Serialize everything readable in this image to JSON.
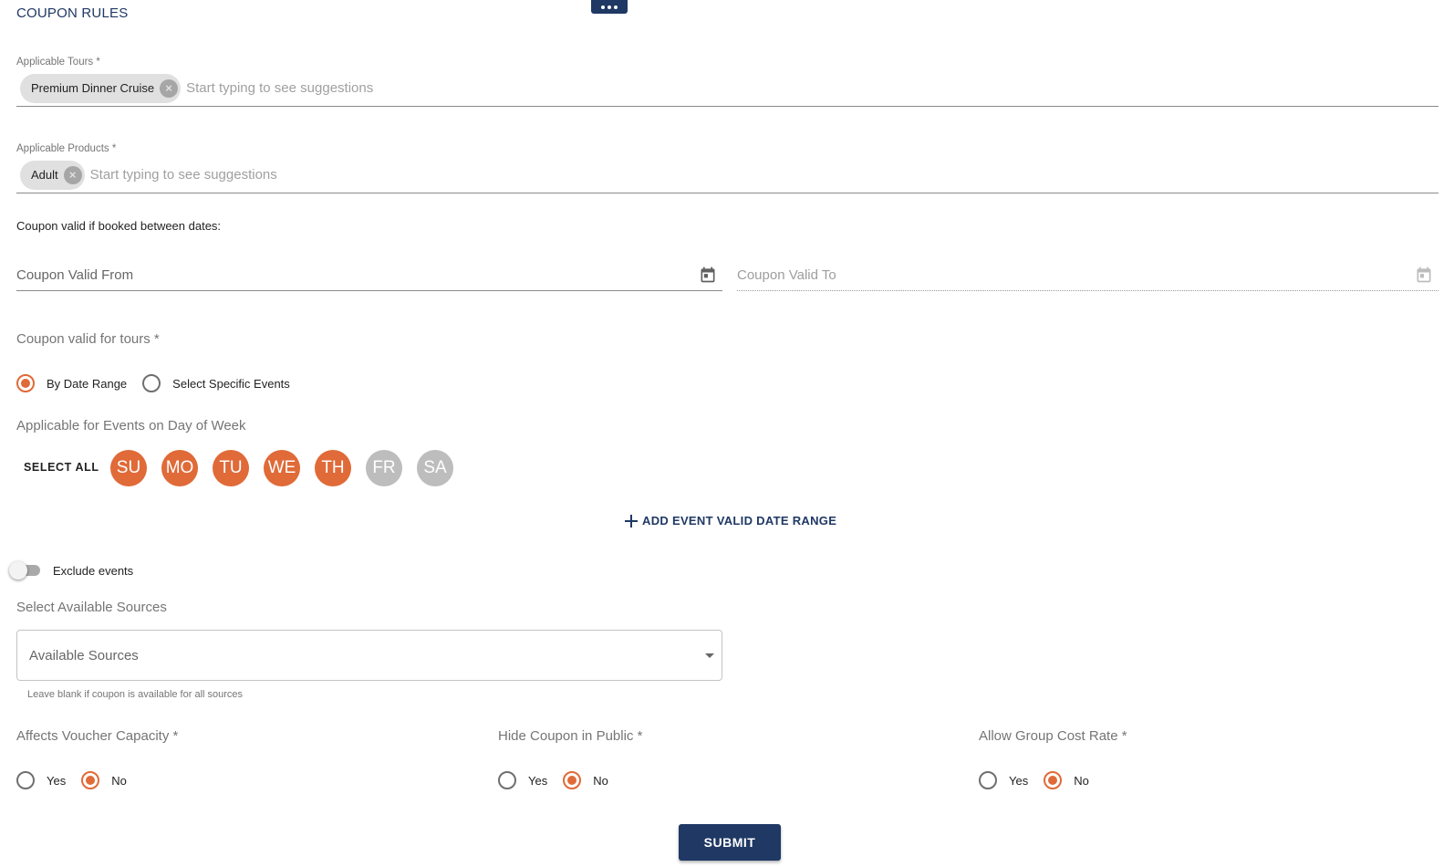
{
  "header": {
    "section_title": "COUPON RULES"
  },
  "tours": {
    "label": "Applicable Tours *",
    "chips": [
      "Premium Dinner Cruise"
    ],
    "placeholder": "Start typing to see suggestions"
  },
  "products": {
    "label": "Applicable Products *",
    "chips": [
      "Adult"
    ],
    "placeholder": "Start typing to see suggestions"
  },
  "booking_dates": {
    "heading": "Coupon valid if booked between dates:",
    "from_placeholder": "Coupon Valid From",
    "to_placeholder": "Coupon Valid To"
  },
  "valid_for_tours": {
    "label": "Coupon valid for tours *",
    "options": [
      "By Date Range",
      "Select Specific Events"
    ],
    "selected": "By Date Range"
  },
  "days_of_week": {
    "label": "Applicable for Events on Day of Week",
    "select_all": "SELECT ALL",
    "days": [
      {
        "label": "SU",
        "selected": true
      },
      {
        "label": "MO",
        "selected": true
      },
      {
        "label": "TU",
        "selected": true
      },
      {
        "label": "WE",
        "selected": true
      },
      {
        "label": "TH",
        "selected": true
      },
      {
        "label": "FR",
        "selected": false
      },
      {
        "label": "SA",
        "selected": false
      }
    ]
  },
  "add_range": {
    "label": "ADD EVENT VALID DATE RANGE"
  },
  "exclude_events": {
    "label": "Exclude events",
    "enabled": false
  },
  "sources": {
    "label": "Select Available Sources",
    "placeholder": "Available Sources",
    "helper": "Leave blank if coupon is available for all sources"
  },
  "voucher_capacity": {
    "label": "Affects Voucher Capacity *",
    "yes": "Yes",
    "no": "No",
    "selected": "No"
  },
  "hide_public": {
    "label": "Hide Coupon in Public *",
    "yes": "Yes",
    "no": "No",
    "selected": "No"
  },
  "group_cost": {
    "label": "Allow Group Cost Rate *",
    "yes": "Yes",
    "no": "No",
    "selected": "No"
  },
  "submit": {
    "label": "SUBMIT"
  },
  "colors": {
    "accent": "#e06a38",
    "primary": "#1f3864",
    "inactive_day": "#bdbdbd"
  }
}
